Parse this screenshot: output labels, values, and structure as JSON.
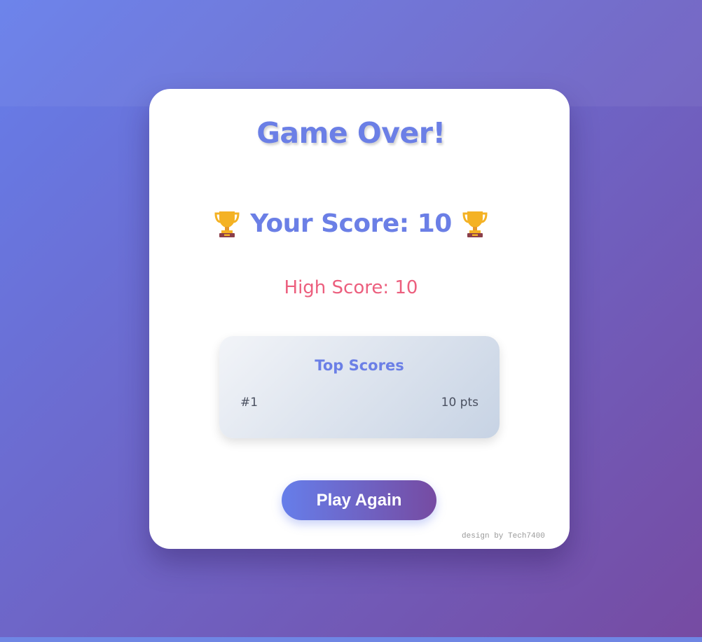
{
  "game": {
    "title": "Game Over!",
    "score_label": "Your Score: 10",
    "high_score_label": "High Score: 10",
    "trophy_icon": "trophy-icon"
  },
  "leaderboard": {
    "title": "Top Scores",
    "entries": [
      {
        "rank": "#1",
        "points": "10 pts"
      }
    ]
  },
  "actions": {
    "play_again_label": "Play Again"
  },
  "footer": {
    "credit": "design by Tech7400"
  },
  "colors": {
    "accent": "#6b7fe6",
    "high_score": "#ec5f7e",
    "gradient_start": "#667eea",
    "gradient_end": "#764ba2"
  }
}
